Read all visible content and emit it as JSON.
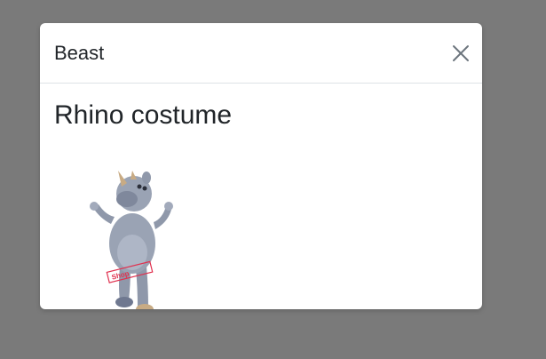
{
  "modal": {
    "title": "Beast",
    "close_icon": "close-icon"
  },
  "body": {
    "item_title": "Rhino costume",
    "image": {
      "subject": "rhino mascot costume",
      "watermark_text": "Shop"
    }
  },
  "colors": {
    "backdrop": "#7a7a7a",
    "modal_bg": "#ffffff",
    "text": "#212529",
    "divider": "#dee2e6",
    "close_icon": "#6c757d",
    "costume_gray": "#9aa3b4",
    "horn": "#c8ab84",
    "watermark": "#e0314f"
  }
}
